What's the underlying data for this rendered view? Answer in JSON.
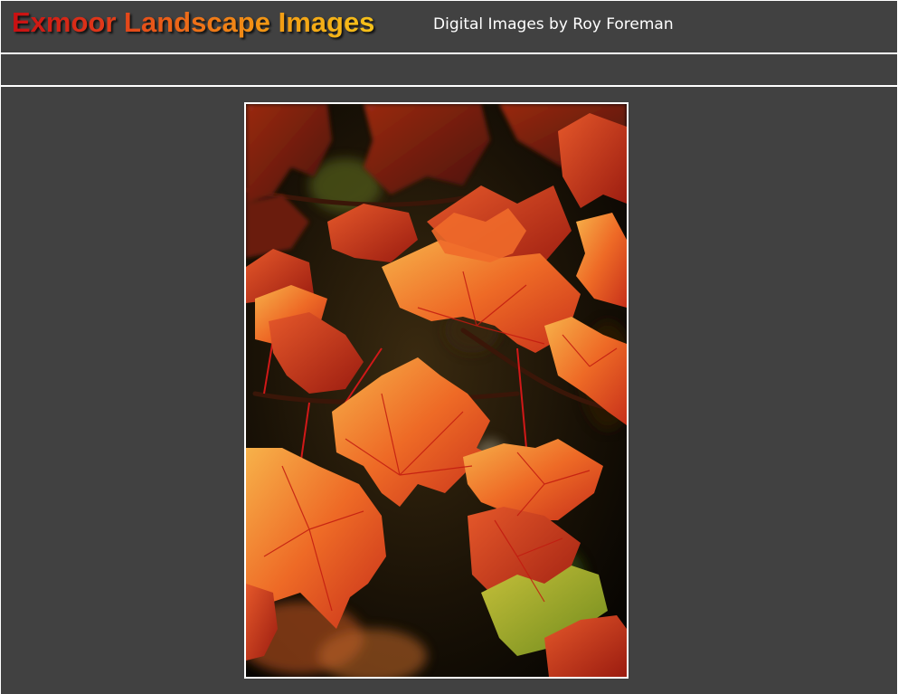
{
  "header": {
    "title": "Exmoor Landscape Images",
    "subtitle": "Digital Images by Roy Foreman"
  },
  "colors": {
    "background": "#414141",
    "rule": "#ffffff",
    "title_gradient_start": "#c80f12",
    "title_gradient_end": "#f6c21a",
    "subtitle": "#ffffff"
  },
  "main": {
    "photo": {
      "subject": "autumn-maple-leaves-photo"
    }
  }
}
